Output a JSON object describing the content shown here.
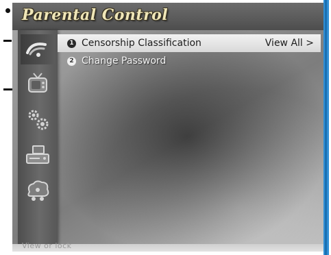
{
  "header": {
    "title": "Parental Control"
  },
  "nav_icons": [
    {
      "name": "satellite-dish-icon",
      "active": true
    },
    {
      "name": "tv-icon",
      "active": false
    },
    {
      "name": "settings-gears-icon",
      "active": false
    },
    {
      "name": "set-top-box-icon",
      "active": false
    },
    {
      "name": "network-icon",
      "active": false
    }
  ],
  "menu": {
    "items": [
      {
        "number": "1",
        "label": "Censorship Classification",
        "value": "View All >",
        "selected": true
      },
      {
        "number": "2",
        "label": "Change Password",
        "value": "",
        "selected": false
      }
    ]
  },
  "footer": {
    "hint": "View or lock"
  },
  "colors": {
    "title": "#efe6b8",
    "frame_edge": "#2f8fd6",
    "selection": "#e6e6e6"
  }
}
